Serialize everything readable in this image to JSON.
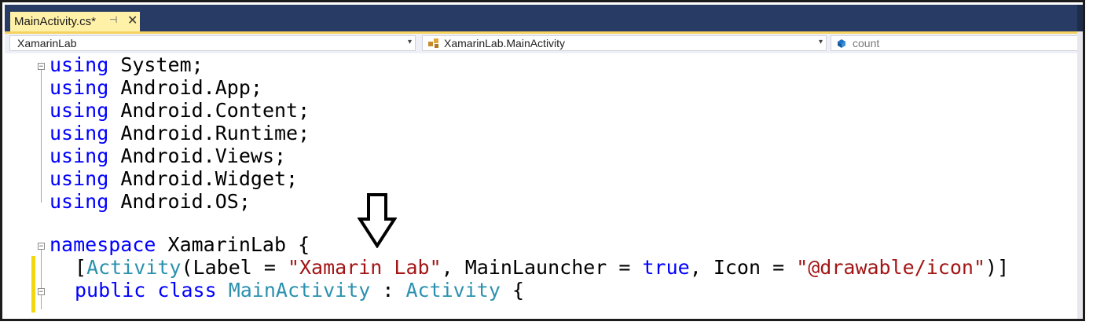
{
  "tab": {
    "title": "MainActivity.cs*",
    "pin_glyph": "⊣",
    "close_glyph": "✕"
  },
  "navbar": {
    "project": "XamarinLab",
    "type": "XamarinLab.MainActivity",
    "member": "count",
    "dropdown_glyph": "▾"
  },
  "code": {
    "usings": [
      "System;",
      "Android.App;",
      "Android.Content;",
      "Android.Runtime;",
      "Android.Views;",
      "Android.Widget;",
      "Android.OS;"
    ],
    "using_kw": "using",
    "ns_kw": "namespace",
    "ns_name": " XamarinLab {",
    "attr": {
      "open": "[",
      "type": "Activity",
      "p1": "(Label = ",
      "label": "\"Xamarin Lab\"",
      "p2": ", MainLauncher = ",
      "bool": "true",
      "p3": ", Icon = ",
      "icon": "\"@drawable/icon\"",
      "close": ")]"
    },
    "class_line": {
      "kw": "public class",
      "name": "MainActivity",
      "sep": " : ",
      "base": "Activity",
      "brace": " {"
    },
    "collapse_glyph": "⊟"
  },
  "colors": {
    "tab_active": "#fff1a8",
    "tabbar": "#283b64",
    "keyword": "#0000ff",
    "type": "#2b91af",
    "string": "#a31515",
    "change_bar": "#f2d60f"
  }
}
